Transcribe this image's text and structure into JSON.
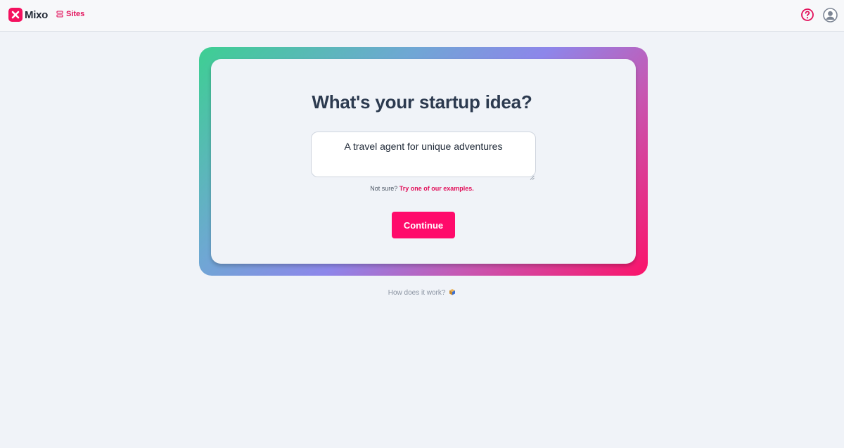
{
  "header": {
    "logo_text": "Mixo",
    "nav_sites_label": "Sites",
    "icons": [
      "mixo-logo-icon",
      "sites-stack-icon",
      "help-circle-icon",
      "user-avatar-icon"
    ],
    "accent_color": "#e2105a"
  },
  "main": {
    "headline": "What's your startup idea?",
    "idea_input_value": "A travel agent for unique adventures",
    "hint_prefix": "Not sure?",
    "hint_link": "Try one of our examples.",
    "continue_label": "Continue",
    "how_it_works": "How does it work?",
    "how_icon": "box-emoji-icon",
    "button_color": "#ff0a6b"
  }
}
